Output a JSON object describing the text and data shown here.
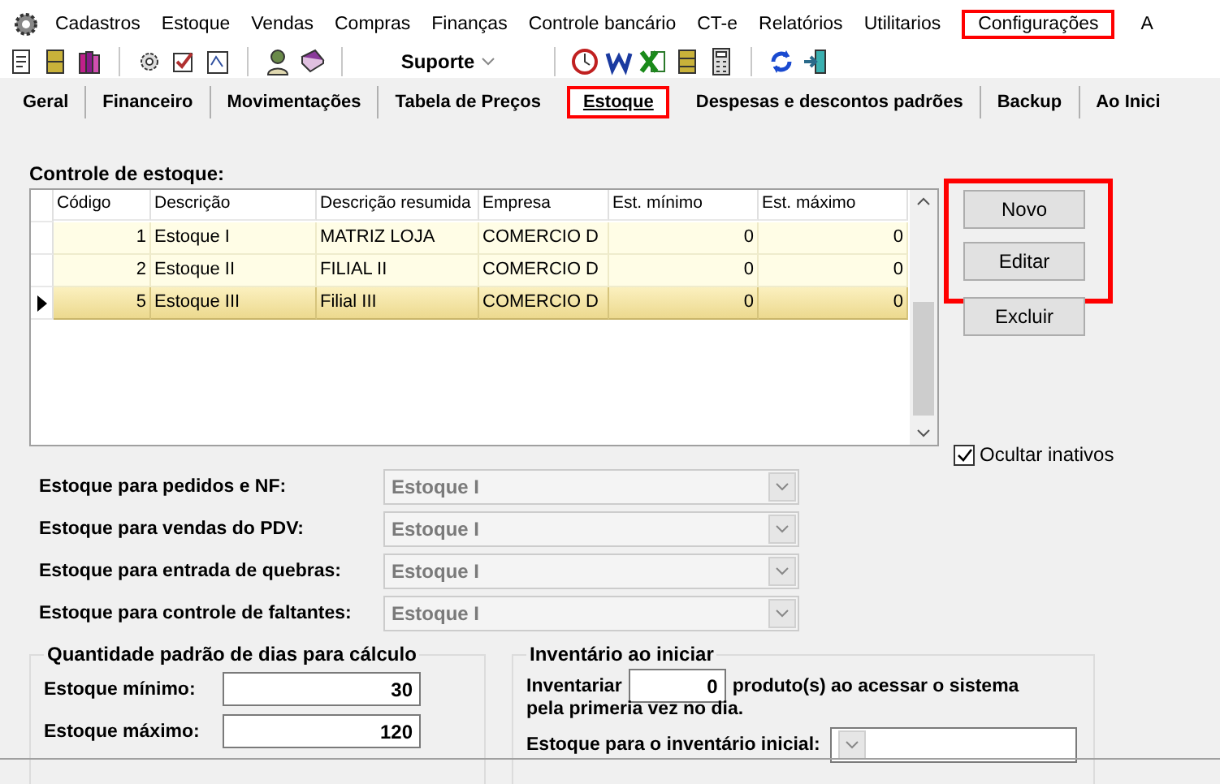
{
  "menu_bar": {
    "items": [
      {
        "label": "Cadastros",
        "highlighted": false
      },
      {
        "label": "Estoque",
        "highlighted": false
      },
      {
        "label": "Vendas",
        "highlighted": false
      },
      {
        "label": "Compras",
        "highlighted": false
      },
      {
        "label": "Finanças",
        "highlighted": false
      },
      {
        "label": "Controle bancário",
        "highlighted": false
      },
      {
        "label": "CT-e",
        "highlighted": false
      },
      {
        "label": "Relatórios",
        "highlighted": false
      },
      {
        "label": "Utilitarios",
        "highlighted": false
      },
      {
        "label": "Configurações",
        "highlighted": true
      },
      {
        "label": "A",
        "highlighted": false
      }
    ]
  },
  "toolbar": {
    "dropdown": "Suporte"
  },
  "tabs": [
    {
      "label": "Geral",
      "selected": false,
      "highlighted": false
    },
    {
      "label": "Financeiro",
      "selected": false,
      "highlighted": false
    },
    {
      "label": "Movimentações",
      "selected": false,
      "highlighted": false
    },
    {
      "label": "Tabela de Preços",
      "selected": false,
      "highlighted": false
    },
    {
      "label": "Estoque",
      "selected": true,
      "highlighted": true
    },
    {
      "label": "Despesas e descontos padrões",
      "selected": false,
      "highlighted": false
    },
    {
      "label": "Backup",
      "selected": false,
      "highlighted": false
    },
    {
      "label": "Ao Inici",
      "selected": false,
      "highlighted": false
    }
  ],
  "stock_control": {
    "title": "Controle de estoque:",
    "table": {
      "columns": [
        "Código",
        "Descrição",
        "Descrição resumida",
        "Empresa",
        "Est. mínimo",
        "Est. máximo"
      ],
      "rows": [
        {
          "cells": [
            "1",
            "Estoque I",
            "MATRIZ LOJA",
            "COMERCIO D",
            "0",
            "0"
          ],
          "selected": false
        },
        {
          "cells": [
            "2",
            "Estoque II",
            "FILIAL II",
            "COMERCIO D",
            "0",
            "0"
          ],
          "selected": false
        },
        {
          "cells": [
            "5",
            "Estoque III",
            "Filial III",
            "COMERCIO D",
            "0",
            "0"
          ],
          "selected": true
        }
      ]
    },
    "buttons": [
      {
        "label": "Novo",
        "highlighted": true
      },
      {
        "label": "Editar",
        "highlighted": true
      },
      {
        "label": "Excluir",
        "highlighted": false
      }
    ],
    "hide_inactive": {
      "label": "Ocultar inativos",
      "checked": true
    }
  },
  "stock_selects": [
    {
      "label": "Estoque para pedidos e NF:",
      "value": "Estoque I",
      "disabled": true
    },
    {
      "label": "Estoque para vendas do PDV:",
      "value": "Estoque I",
      "disabled": true
    },
    {
      "label": "Estoque para entrada de quebras:",
      "value": "Estoque I",
      "disabled": true
    },
    {
      "label": "Estoque para controle de faltantes:",
      "value": "Estoque I",
      "disabled": true
    }
  ],
  "default_days": {
    "title": "Quantidade padrão de dias para cálculo",
    "fields": [
      {
        "label": "Estoque mínimo:",
        "value": "30"
      },
      {
        "label": "Estoque máximo:",
        "value": "120"
      }
    ]
  },
  "startup_inventory": {
    "title": "Inventário ao iniciar",
    "prefix": "Inventariar",
    "count": "0",
    "suffix_line_1": "produto(s) ao acessar o sistema",
    "suffix_line_2": "pela primeria vez no dia.",
    "select_label": "Estoque para o inventário inicial:"
  }
}
